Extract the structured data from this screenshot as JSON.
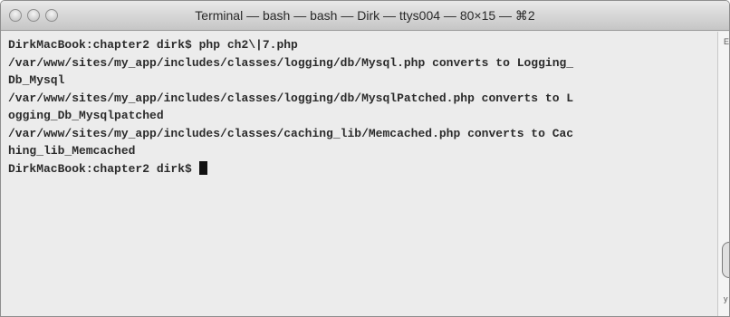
{
  "window": {
    "title": "Terminal — bash — bash — Dirk — ttys004 — 80×15 — ⌘2"
  },
  "terminal": {
    "lines": [
      "DirkMacBook:chapter2 dirk$ php ch2\\|7.php",
      "/var/www/sites/my_app/includes/classes/logging/db/Mysql.php converts to Logging_",
      "Db_Mysql",
      "/var/www/sites/my_app/includes/classes/logging/db/MysqlPatched.php converts to L",
      "ogging_Db_Mysqlpatched",
      "/var/www/sites/my_app/includes/classes/caching_lib/Memcached.php converts to Cac",
      "hing_lib_Memcached"
    ],
    "prompt": "DirkMacBook:chapter2 dirk$ "
  },
  "edge_marks": {
    "top": "E",
    "bottom": "y"
  }
}
